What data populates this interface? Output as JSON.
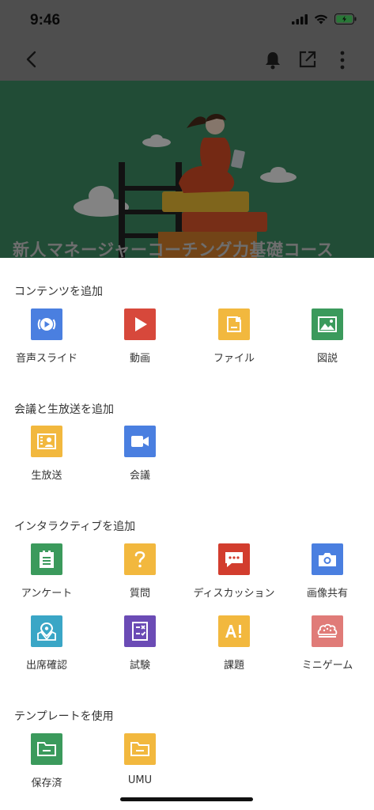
{
  "status_bar": {
    "time": "9:46"
  },
  "banner": {
    "course_title": "新人マネージャーコーチング力基礎コース"
  },
  "sections": [
    {
      "title": "コンテンツを追加",
      "items": [
        {
          "label": "音声スライド",
          "icon": "audio-slide-icon",
          "color": "#4a7fe0"
        },
        {
          "label": "動画",
          "icon": "video-play-icon",
          "color": "#d7483b"
        },
        {
          "label": "ファイル",
          "icon": "file-icon",
          "color": "#f2b83e"
        },
        {
          "label": "図説",
          "icon": "image-icon",
          "color": "#3b9a5c"
        }
      ]
    },
    {
      "title": "会議と生放送を追加",
      "items": [
        {
          "label": "生放送",
          "icon": "live-broadcast-icon",
          "color": "#f2b83e"
        },
        {
          "label": "会議",
          "icon": "video-camera-icon",
          "color": "#4a7fe0"
        }
      ]
    },
    {
      "title": "インタラクティブを追加",
      "items": [
        {
          "label": "アンケート",
          "icon": "survey-icon",
          "color": "#3b9a5c"
        },
        {
          "label": "質問",
          "icon": "question-icon",
          "color": "#f2b83e"
        },
        {
          "label": "ディスカッション",
          "icon": "discussion-icon",
          "color": "#d23d2e"
        },
        {
          "label": "画像共有",
          "icon": "camera-icon",
          "color": "#4a7fe0"
        },
        {
          "label": "出席確認",
          "icon": "map-pin-icon",
          "color": "#3aa6c6"
        },
        {
          "label": "試験",
          "icon": "exam-icon",
          "color": "#6b4bb5"
        },
        {
          "label": "課題",
          "icon": "assignment-icon",
          "color": "#f2b83e"
        },
        {
          "label": "ミニゲーム",
          "icon": "brain-icon",
          "color": "#e07b78"
        }
      ]
    },
    {
      "title": "テンプレートを使用",
      "items": [
        {
          "label": "保存済",
          "icon": "folder-icon",
          "color": "#3b9a5c"
        },
        {
          "label": "UMU",
          "icon": "folder-icon",
          "color": "#f2b83e"
        }
      ]
    }
  ]
}
